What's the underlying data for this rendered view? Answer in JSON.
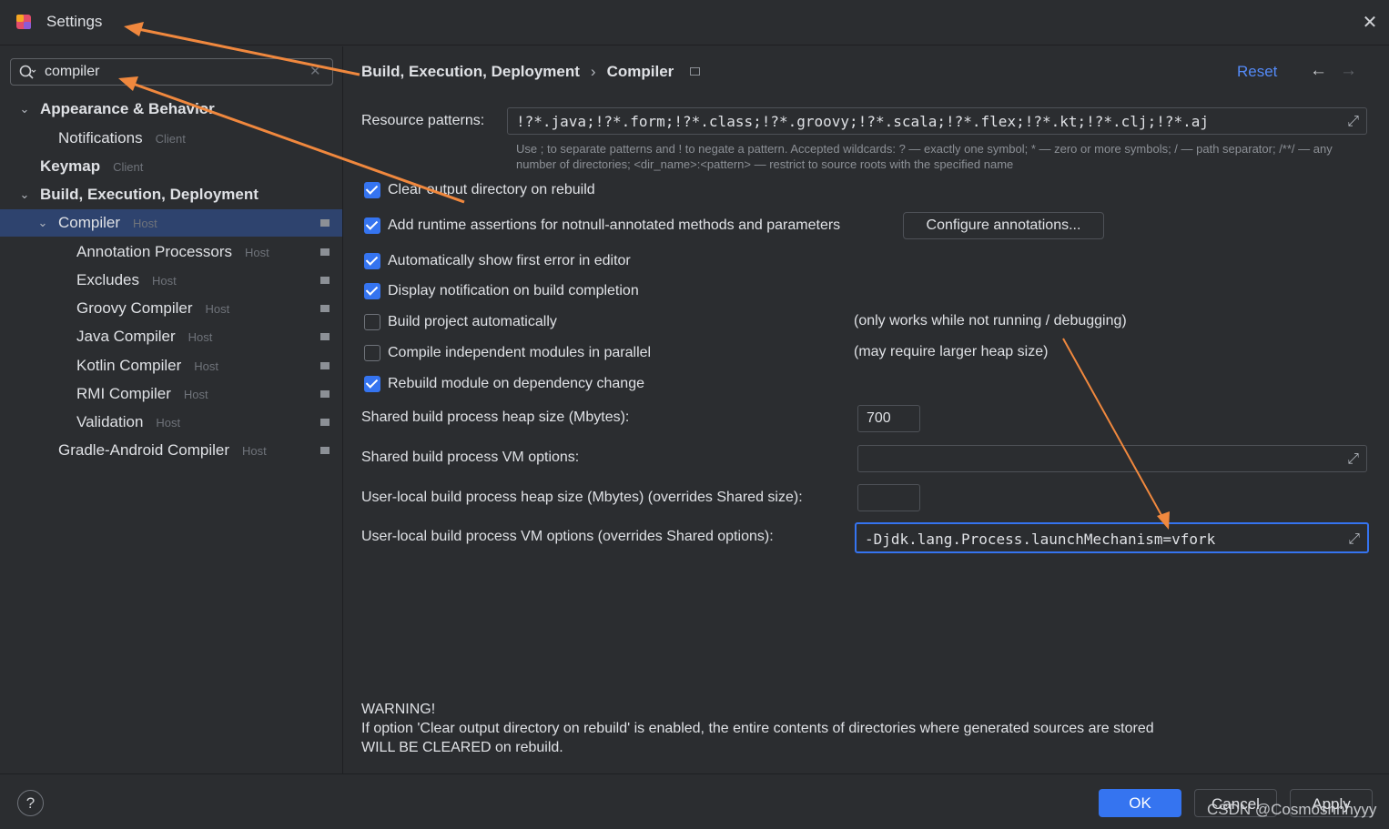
{
  "window": {
    "title": "Settings"
  },
  "search": {
    "value": "compiler"
  },
  "sidebar": {
    "items": [
      {
        "label": "Appearance & Behavior",
        "tag": ""
      },
      {
        "label": "Notifications",
        "tag": "Client"
      },
      {
        "label": "Keymap",
        "tag": "Client"
      },
      {
        "label": "Build, Execution, Deployment",
        "tag": ""
      },
      {
        "label": "Compiler",
        "tag": "Host"
      },
      {
        "label": "Annotation Processors",
        "tag": "Host"
      },
      {
        "label": "Excludes",
        "tag": "Host"
      },
      {
        "label": "Groovy Compiler",
        "tag": "Host"
      },
      {
        "label": "Java Compiler",
        "tag": "Host"
      },
      {
        "label": "Kotlin Compiler",
        "tag": "Host"
      },
      {
        "label": "RMI Compiler",
        "tag": "Host"
      },
      {
        "label": "Validation",
        "tag": "Host"
      },
      {
        "label": "Gradle-Android Compiler",
        "tag": "Host"
      }
    ]
  },
  "header": {
    "crumb_parent": "Build, Execution, Deployment",
    "crumb_sep": "›",
    "crumb_current": "Compiler",
    "reset": "Reset"
  },
  "form": {
    "resource_label": "Resource patterns:",
    "resource_value": "!?*.java;!?*.form;!?*.class;!?*.groovy;!?*.scala;!?*.flex;!?*.kt;!?*.clj;!?*.aj",
    "resource_hint": "Use ; to separate patterns and ! to negate a pattern. Accepted wildcards: ? — exactly one symbol; * — zero or more symbols; / — path separator; /**/ — any number of directories; <dir_name>:<pattern> — restrict to source roots with the specified name",
    "checkboxes": [
      {
        "label": "Clear output directory on rebuild",
        "checked": true,
        "note": ""
      },
      {
        "label": "Add runtime assertions for notnull-annotated methods and parameters",
        "checked": true,
        "note": ""
      },
      {
        "label": "Automatically show first error in editor",
        "checked": true,
        "note": ""
      },
      {
        "label": "Display notification on build completion",
        "checked": true,
        "note": ""
      },
      {
        "label": "Build project automatically",
        "checked": false,
        "note": "(only works while not running / debugging)"
      },
      {
        "label": "Compile independent modules in parallel",
        "checked": false,
        "note": "(may require larger heap size)"
      },
      {
        "label": "Rebuild module on dependency change",
        "checked": true,
        "note": ""
      }
    ],
    "configure_btn": "Configure annotations...",
    "heap_label": "Shared build process heap size (Mbytes):",
    "heap_value": "700",
    "vm_label": "Shared build process VM options:",
    "vm_value": "",
    "user_heap_label": "User-local build process heap size (Mbytes) (overrides Shared size):",
    "user_heap_value": "",
    "user_vm_label": "User-local build process VM options (overrides Shared options):",
    "user_vm_value": "-Djdk.lang.Process.launchMechanism=vfork"
  },
  "warning": {
    "title": "WARNING!",
    "line1": "If option 'Clear output directory on rebuild' is enabled, the entire contents of directories where generated sources are stored",
    "line2": "WILL BE CLEARED on rebuild."
  },
  "footer": {
    "help": "?",
    "ok": "OK",
    "cancel": "Cancel",
    "apply": "Apply"
  },
  "watermark": "CSDN @Cosmoshhhyyy",
  "colors": {
    "accent": "#3574f0",
    "annotation": "#f0883e",
    "selection": "#2e436e",
    "bg": "#2b2d30"
  }
}
